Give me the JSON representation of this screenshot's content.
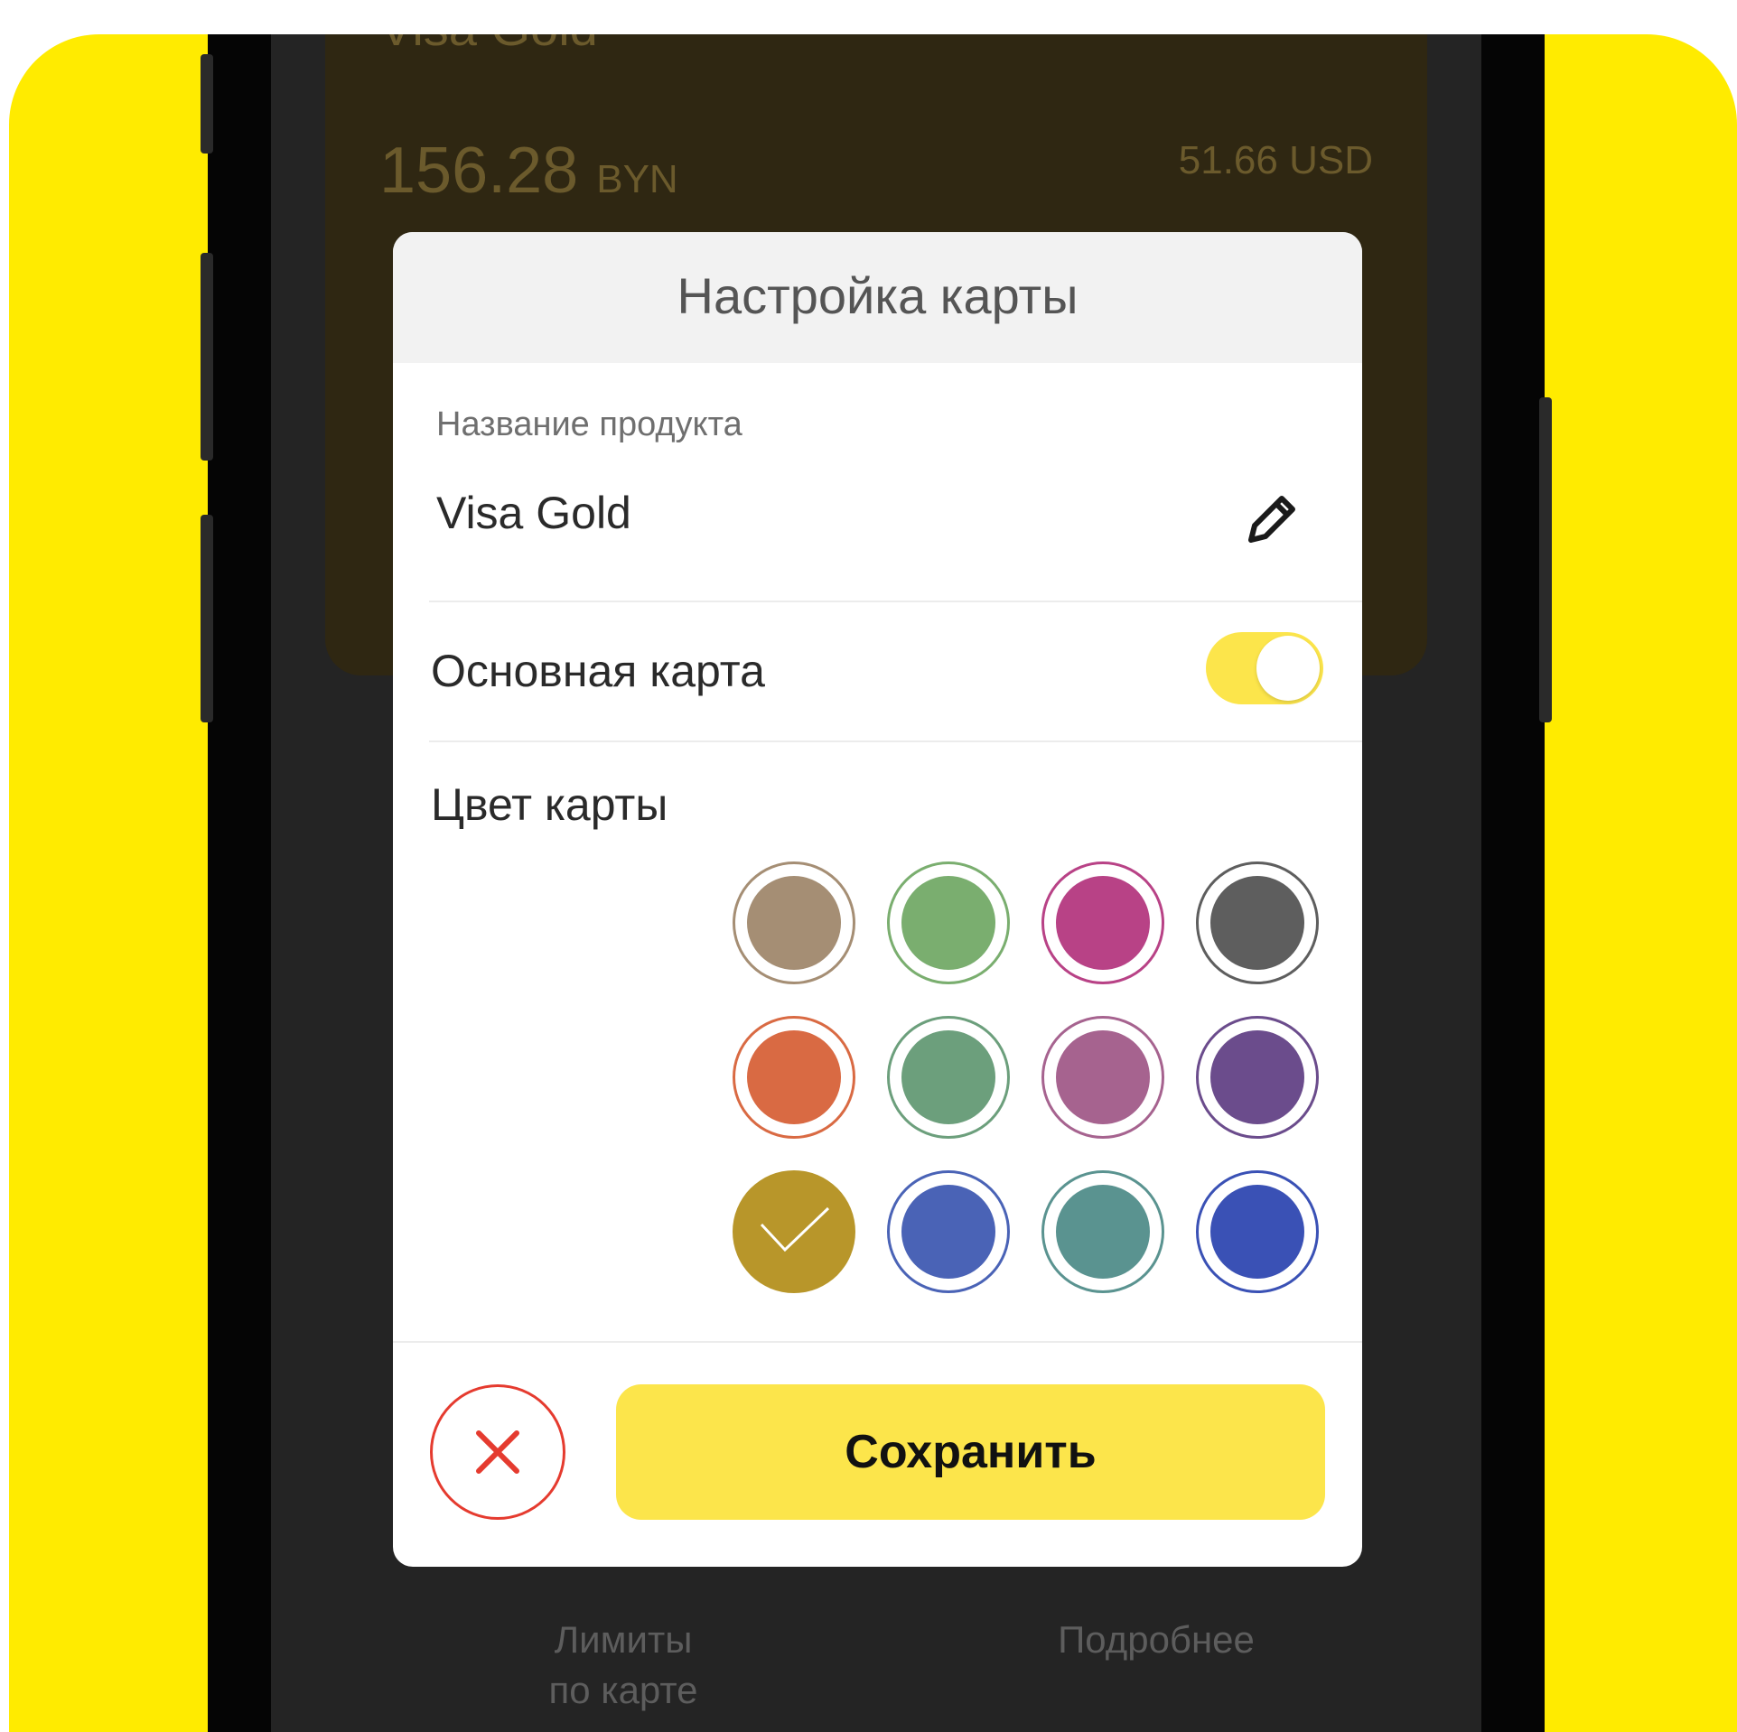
{
  "background_card": {
    "title": "Visa Gold",
    "balance_amount": "156.28",
    "balance_currency": "BYN",
    "secondary_balance": "51.66 USD"
  },
  "bottom_links": {
    "limits_line1": "Лимиты",
    "limits_line2": "по карте",
    "details": "Подробнее"
  },
  "modal": {
    "title": "Настройка карты",
    "product_name_label": "Название продукта",
    "product_name_value": "Visa Gold",
    "edit_icon": "pencil-icon",
    "main_card_label": "Основная карта",
    "main_card_enabled": true,
    "card_color_label": "Цвет карты",
    "colors": [
      {
        "name": "taupe",
        "fill": "#A58E74",
        "ring": "#A58E74",
        "selected": false
      },
      {
        "name": "green",
        "fill": "#7AAE6F",
        "ring": "#7AAE6F",
        "selected": false
      },
      {
        "name": "magenta",
        "fill": "#B84286",
        "ring": "#B84286",
        "selected": false
      },
      {
        "name": "gray",
        "fill": "#5E5E5E",
        "ring": "#5E5E5E",
        "selected": false
      },
      {
        "name": "orange",
        "fill": "#D96A43",
        "ring": "#D96A43",
        "selected": false
      },
      {
        "name": "sage",
        "fill": "#6C9F7C",
        "ring": "#6C9F7C",
        "selected": false
      },
      {
        "name": "orchid",
        "fill": "#A6638F",
        "ring": "#A6638F",
        "selected": false
      },
      {
        "name": "purple",
        "fill": "#6B4C8C",
        "ring": "#6B4C8C",
        "selected": false
      },
      {
        "name": "gold",
        "fill": "#B8962A",
        "ring": "#B8962A",
        "selected": true
      },
      {
        "name": "blue",
        "fill": "#4A63B6",
        "ring": "#4A63B6",
        "selected": false
      },
      {
        "name": "teal",
        "fill": "#5A9390",
        "ring": "#5A9390",
        "selected": false
      },
      {
        "name": "royal-blue",
        "fill": "#3A51B5",
        "ring": "#3A51B5",
        "selected": false
      }
    ],
    "cancel_icon": "close-icon",
    "save_label": "Сохранить"
  },
  "colors": {
    "accent_yellow": "#FCE54B",
    "page_yellow": "#FFEB00",
    "cancel_red": "#E53B2F"
  }
}
